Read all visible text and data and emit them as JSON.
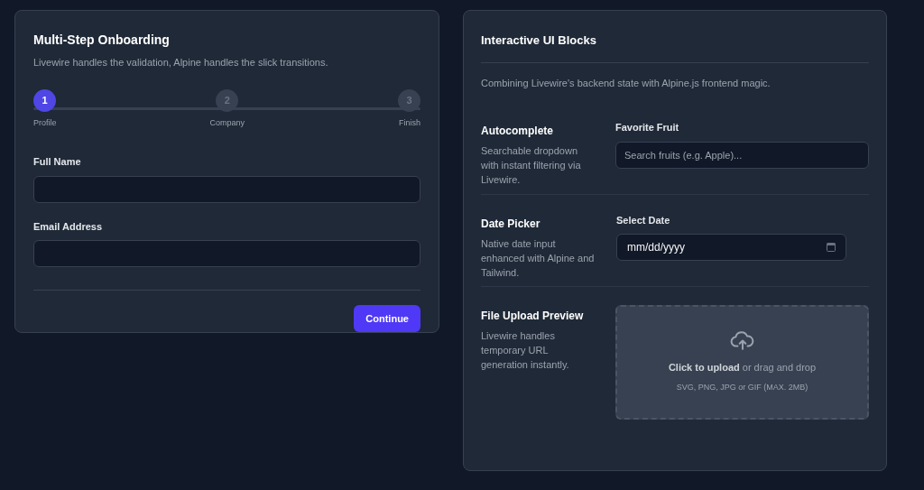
{
  "onboarding": {
    "title": "Multi-Step Onboarding",
    "subtitle": "Livewire handles the validation, Alpine handles the slick transitions.",
    "steps": [
      {
        "number": "1",
        "label": "Profile",
        "selected": true
      },
      {
        "number": "2",
        "label": "Company",
        "selected": false
      },
      {
        "number": "3",
        "label": "Finish",
        "selected": false
      }
    ],
    "fields": [
      {
        "label": "Full Name"
      },
      {
        "label": "Email Address"
      }
    ],
    "button": "Continue"
  },
  "blocks": {
    "title": "Interactive UI Blocks",
    "subtitle": "Combining Livewire's backend state with Alpine.js frontend magic.",
    "sections": [
      {
        "kind": "text_field",
        "title": "Autocomplete",
        "description": "Searchable dropdown with instant filtering via Livewire.",
        "field_label": "Favorite Fruit",
        "placeholder": "Search fruits (e.g. Apple)..."
      },
      {
        "kind": "date_field",
        "title": "Date Picker",
        "description": "Native date input enhanced with Alpine and Tailwind.",
        "field_label": "Select Date",
        "value": "mm/dd/yyyy"
      },
      {
        "kind": "upload",
        "title": "File Upload Preview",
        "description": "Livewire handles temporary URL generation instantly.",
        "prompt": "**Click to upload** or drag and drop",
        "hint": "SVG, PNG, JPG or GIF (MAX. 2MB)"
      }
    ]
  }
}
